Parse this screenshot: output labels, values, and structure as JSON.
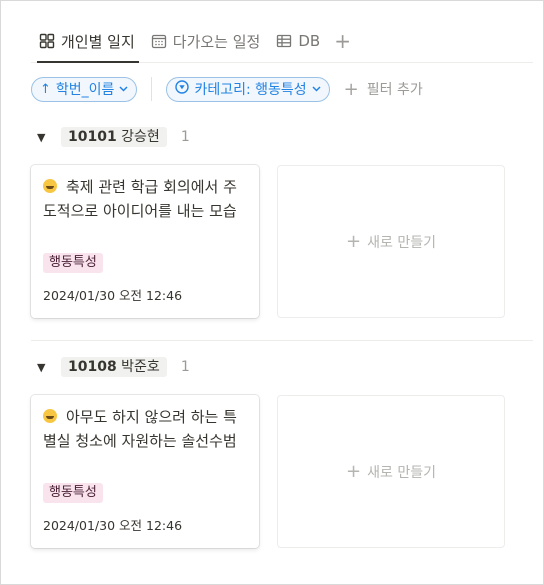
{
  "tabs": [
    {
      "label": "개인별 일지",
      "icon": "board-icon",
      "active": true
    },
    {
      "label": "다가오는 일정",
      "icon": "calendar-icon",
      "active": false
    },
    {
      "label": "DB",
      "icon": "table-icon",
      "active": false
    }
  ],
  "tab_add_label": "+",
  "filters": {
    "sort_chip": {
      "icon": "↑",
      "label": "학번_이름",
      "chevron": "⌄"
    },
    "category_chip": {
      "icon": "▽",
      "label": "카테고리: 행동특성",
      "chevron": "⌄"
    },
    "add_filter": {
      "plus": "+",
      "label": "필터 추가"
    }
  },
  "groups": [
    {
      "id_label": "10101",
      "name": "강승현",
      "count": "1",
      "card": {
        "title": "축제 관련 학급 회의에서 주도적으로 아이디어를 내는 모습",
        "tag": "행동특성",
        "date": "2024/01/30 오전 12:46"
      },
      "new_label": "새로 만들기"
    },
    {
      "id_label": "10108",
      "name": "박준호",
      "count": "1",
      "card": {
        "title": "아무도 하지 않으려 하는 특별실 청소에 자원하는 솔선수범",
        "tag": "행동특성",
        "date": "2024/01/30 오전 12:46"
      },
      "new_label": "새로 만들기"
    }
  ],
  "colors": {
    "accent_blue": "#2383e2",
    "tag_pink_bg": "#f9e3ec",
    "text": "#37352f",
    "muted": "#9b9a97"
  }
}
